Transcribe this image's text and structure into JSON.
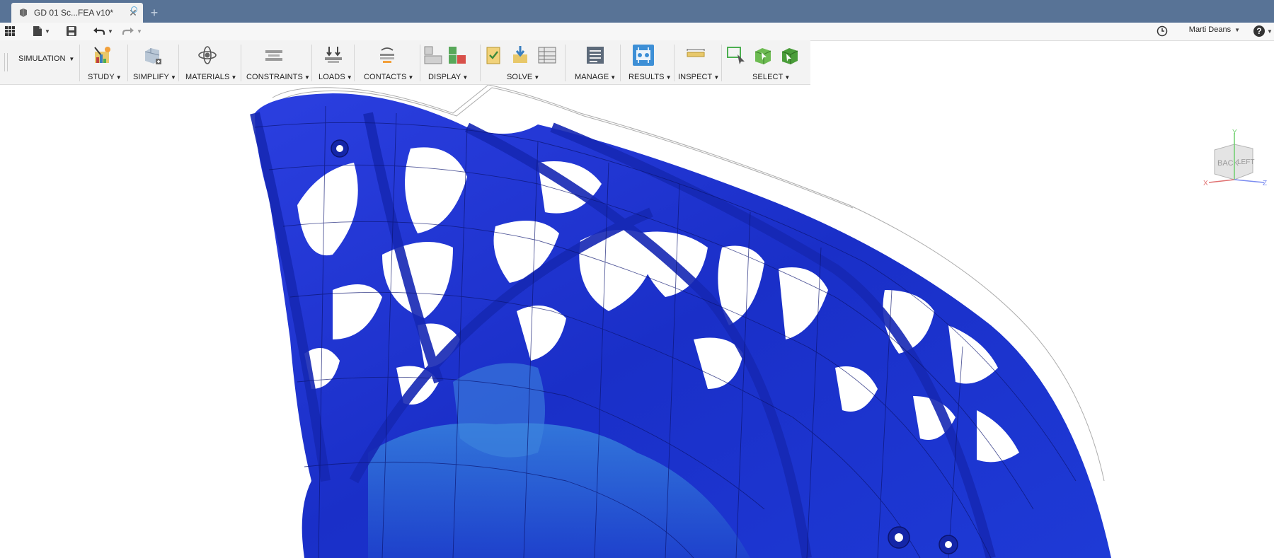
{
  "tab": {
    "title": "GD 01 Sc...FEA v10*",
    "close_glyph": "✕",
    "new_tab_glyph": "+"
  },
  "qat": {
    "grid_icon": "app-grid-icon",
    "file_icon": "file-icon",
    "save_icon": "save-icon",
    "undo_icon": "undo-icon",
    "redo_icon": "redo-icon",
    "clock_icon": "job-status-icon",
    "user_name": "Marti Deans",
    "help_icon": "help-icon",
    "help_glyph": "?"
  },
  "ribbon": {
    "workspace": "SIMULATION",
    "groups": [
      {
        "label": "STUDY"
      },
      {
        "label": "SIMPLIFY"
      },
      {
        "label": "MATERIALS"
      },
      {
        "label": "CONSTRAINTS"
      },
      {
        "label": "LOADS"
      },
      {
        "label": "CONTACTS"
      },
      {
        "label": "DISPLAY"
      },
      {
        "label": "SOLVE"
      },
      {
        "label": "MANAGE"
      },
      {
        "label": "RESULTS"
      },
      {
        "label": "INSPECT"
      },
      {
        "label": "SELECT"
      }
    ]
  },
  "viewcube": {
    "faces": [
      "BACK",
      "LEFT"
    ],
    "axes": [
      "X",
      "Y",
      "Z"
    ]
  },
  "colors": {
    "title_bar": "#587396",
    "model_blue": "#1e36d2",
    "results_highlight": "#3d8fd6"
  }
}
